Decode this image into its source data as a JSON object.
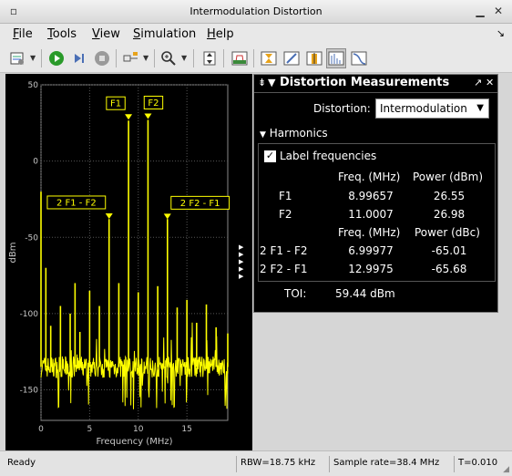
{
  "window": {
    "title": "Intermodulation Distortion"
  },
  "menu": [
    {
      "label": "File",
      "mnemonic": "F",
      "rest": "ile"
    },
    {
      "label": "Tools",
      "mnemonic": "T",
      "rest": "ools"
    },
    {
      "label": "View",
      "mnemonic": "V",
      "rest": "iew"
    },
    {
      "label": "Simulation",
      "mnemonic": "S",
      "rest": "imulation"
    },
    {
      "label": "Help",
      "mnemonic": "H",
      "rest": "elp"
    }
  ],
  "toolbar_icons": [
    "settings-icon",
    "run-icon",
    "step-forward-icon",
    "stop-icon",
    "signal-select-icon",
    "zoom-icon",
    "autoscale-icon",
    "spectrum-mask-icon",
    "data-cursors-icon",
    "peak-finder-icon",
    "channel-measurements-icon",
    "distortion-measurements-icon",
    "ccdf-icon"
  ],
  "plot": {
    "ylabel": "dBm",
    "xlabel": "Frequency (MHz)",
    "yticks": [
      "50",
      "0",
      "-50",
      "-100",
      "-150"
    ],
    "xticks": [
      "0",
      "5",
      "10",
      "15"
    ],
    "markers": [
      {
        "label": "F1",
        "freq": 8.99657,
        "power": 26.55
      },
      {
        "label": "F2",
        "freq": 11.0007,
        "power": 26.98
      },
      {
        "label": "2 F1 - F2",
        "freq": 6.99977,
        "power": -38.46
      },
      {
        "label": "2 F2 - F1",
        "freq": 12.9975,
        "power": -38.7
      }
    ],
    "line_color": "#ffff00"
  },
  "chart_data": {
    "type": "line",
    "title": "",
    "xlabel": "Frequency (MHz)",
    "ylabel": "dBm",
    "xlim": [
      0,
      19.2
    ],
    "ylim": [
      -170,
      50
    ],
    "series": [
      {
        "x": [
          0,
          0.5,
          1.0,
          2.0,
          3.0,
          3.5,
          4.0,
          5.0,
          6.0,
          7.0,
          8.0,
          9.0,
          10.0,
          11.0,
          12.0,
          13.0,
          14.0,
          15.0,
          16.0,
          17.0,
          18.0,
          19.2
        ],
        "y": [
          -20,
          -70,
          -108,
          -95,
          -100,
          -80,
          -112,
          -85,
          -95,
          -38,
          -80,
          26.55,
          -86,
          26.98,
          -82,
          -38,
          -96,
          -91,
          -106,
          -94,
          -109,
          -113
        ]
      }
    ],
    "noise_floor": -135
  },
  "panel": {
    "title": "Distortion Measurements",
    "distortion_label": "Distortion:",
    "distortion_value": "Intermodulation",
    "harmonics_label": "Harmonics",
    "label_frequencies": "Label frequencies",
    "col_freq": "Freq. (MHz)",
    "col_power_dbm": "Power (dBm)",
    "col_power_dbc": "Power (dBc)",
    "fundamentals": [
      {
        "name": "F1",
        "freq": "8.99657",
        "power": "26.55"
      },
      {
        "name": "F2",
        "freq": "11.0007",
        "power": "26.98"
      }
    ],
    "products": [
      {
        "name": "2 F1 - F2",
        "freq": "6.99977",
        "power": "-65.01"
      },
      {
        "name": "2 F2 - F1",
        "freq": "12.9975",
        "power": "-65.68"
      }
    ],
    "toi_label": "TOI:",
    "toi_value": "59.44 dBm"
  },
  "status": {
    "ready": "Ready",
    "rbw": "RBW=18.75 kHz",
    "sample_rate": "Sample rate=38.4 MHz",
    "time": "T=0.010"
  }
}
